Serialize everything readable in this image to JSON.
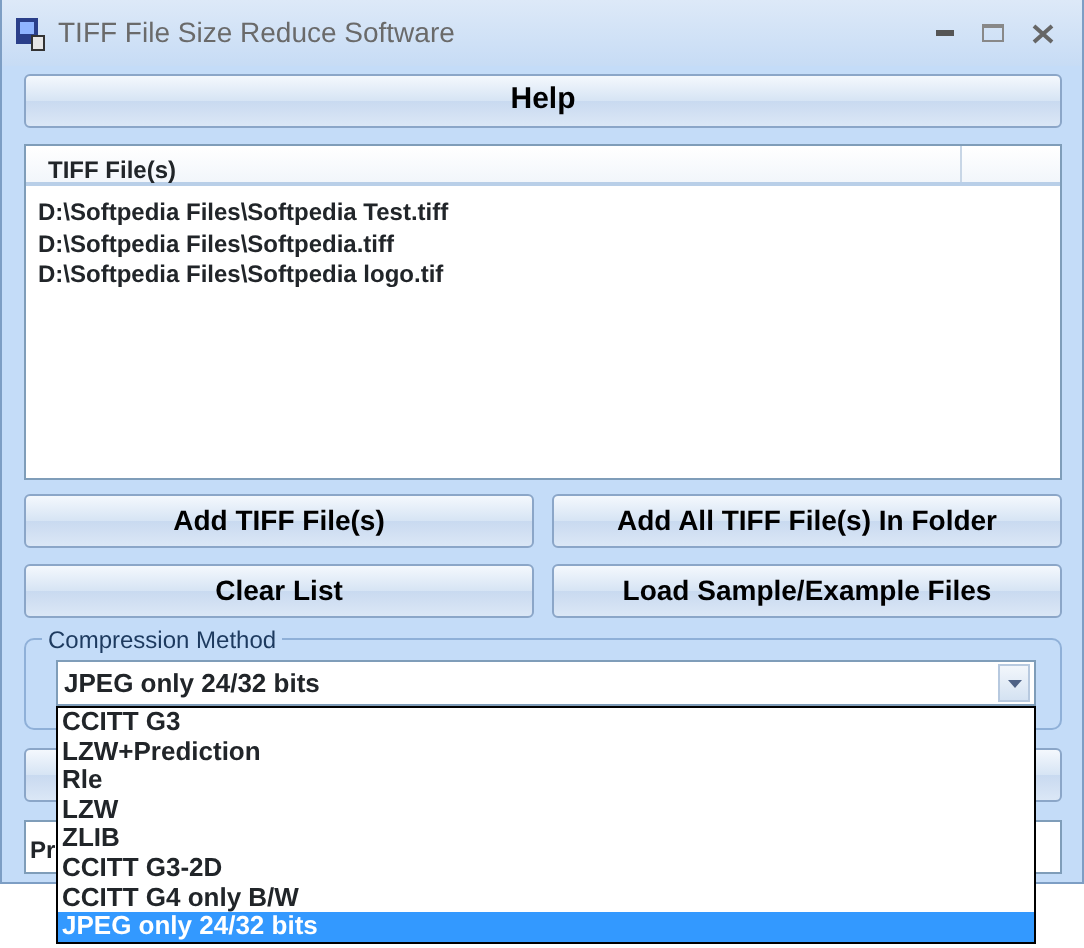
{
  "window": {
    "title": "TIFF File Size Reduce Software"
  },
  "help_button": "Help",
  "file_list": {
    "columns": [
      "TIFF File(s)"
    ],
    "rows": [
      "D:\\Softpedia Files\\Softpedia Test.tiff",
      "D:\\Softpedia Files\\Softpedia.tiff",
      "D:\\Softpedia Files\\Softpedia logo.tif"
    ]
  },
  "buttons": [
    "Add TIFF File(s)",
    "Add All TIFF File(s) In Folder",
    "Clear List",
    "Load Sample/Example Files"
  ],
  "compression": {
    "label": "Compression Method",
    "value": "JPEG only 24/32 bits",
    "options": [
      {
        "label": "CCITT G3",
        "selected": false
      },
      {
        "label": "LZW+Prediction",
        "selected": false
      },
      {
        "label": "Rle",
        "selected": false
      },
      {
        "label": "LZW",
        "selected": false
      },
      {
        "label": "ZLIB",
        "selected": false
      },
      {
        "label": "CCITT G3-2D",
        "selected": false
      },
      {
        "label": "CCITT G4 only B/W",
        "selected": false
      },
      {
        "label": "JPEG only 24/32 bits",
        "selected": true
      }
    ]
  },
  "output_field": {
    "value": "Pr"
  }
}
